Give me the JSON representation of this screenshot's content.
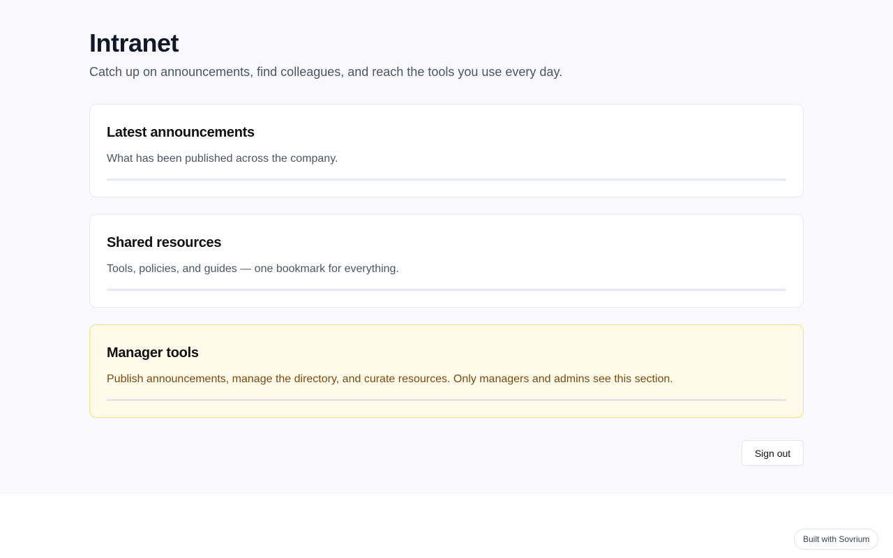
{
  "header": {
    "title": "Intranet",
    "subtitle": "Catch up on announcements, find colleagues, and reach the tools you use every day."
  },
  "sections": [
    {
      "title": "Latest announcements",
      "description": "What has been published across the company."
    },
    {
      "title": "Shared resources",
      "description": "Tools, policies, and guides — one bookmark for everything."
    },
    {
      "title": "Manager tools",
      "description": "Publish announcements, manage the directory, and curate resources. Only managers and admins see this section."
    }
  ],
  "actions": {
    "sign_out_label": "Sign out"
  },
  "footer": {
    "badge_label": "Built with Sovrium"
  },
  "colors": {
    "page_background": "#f9f9fd",
    "manager_card_background": "#fffaea",
    "manager_card_border": "#f3df7e",
    "manager_text": "#7a4a0e"
  }
}
